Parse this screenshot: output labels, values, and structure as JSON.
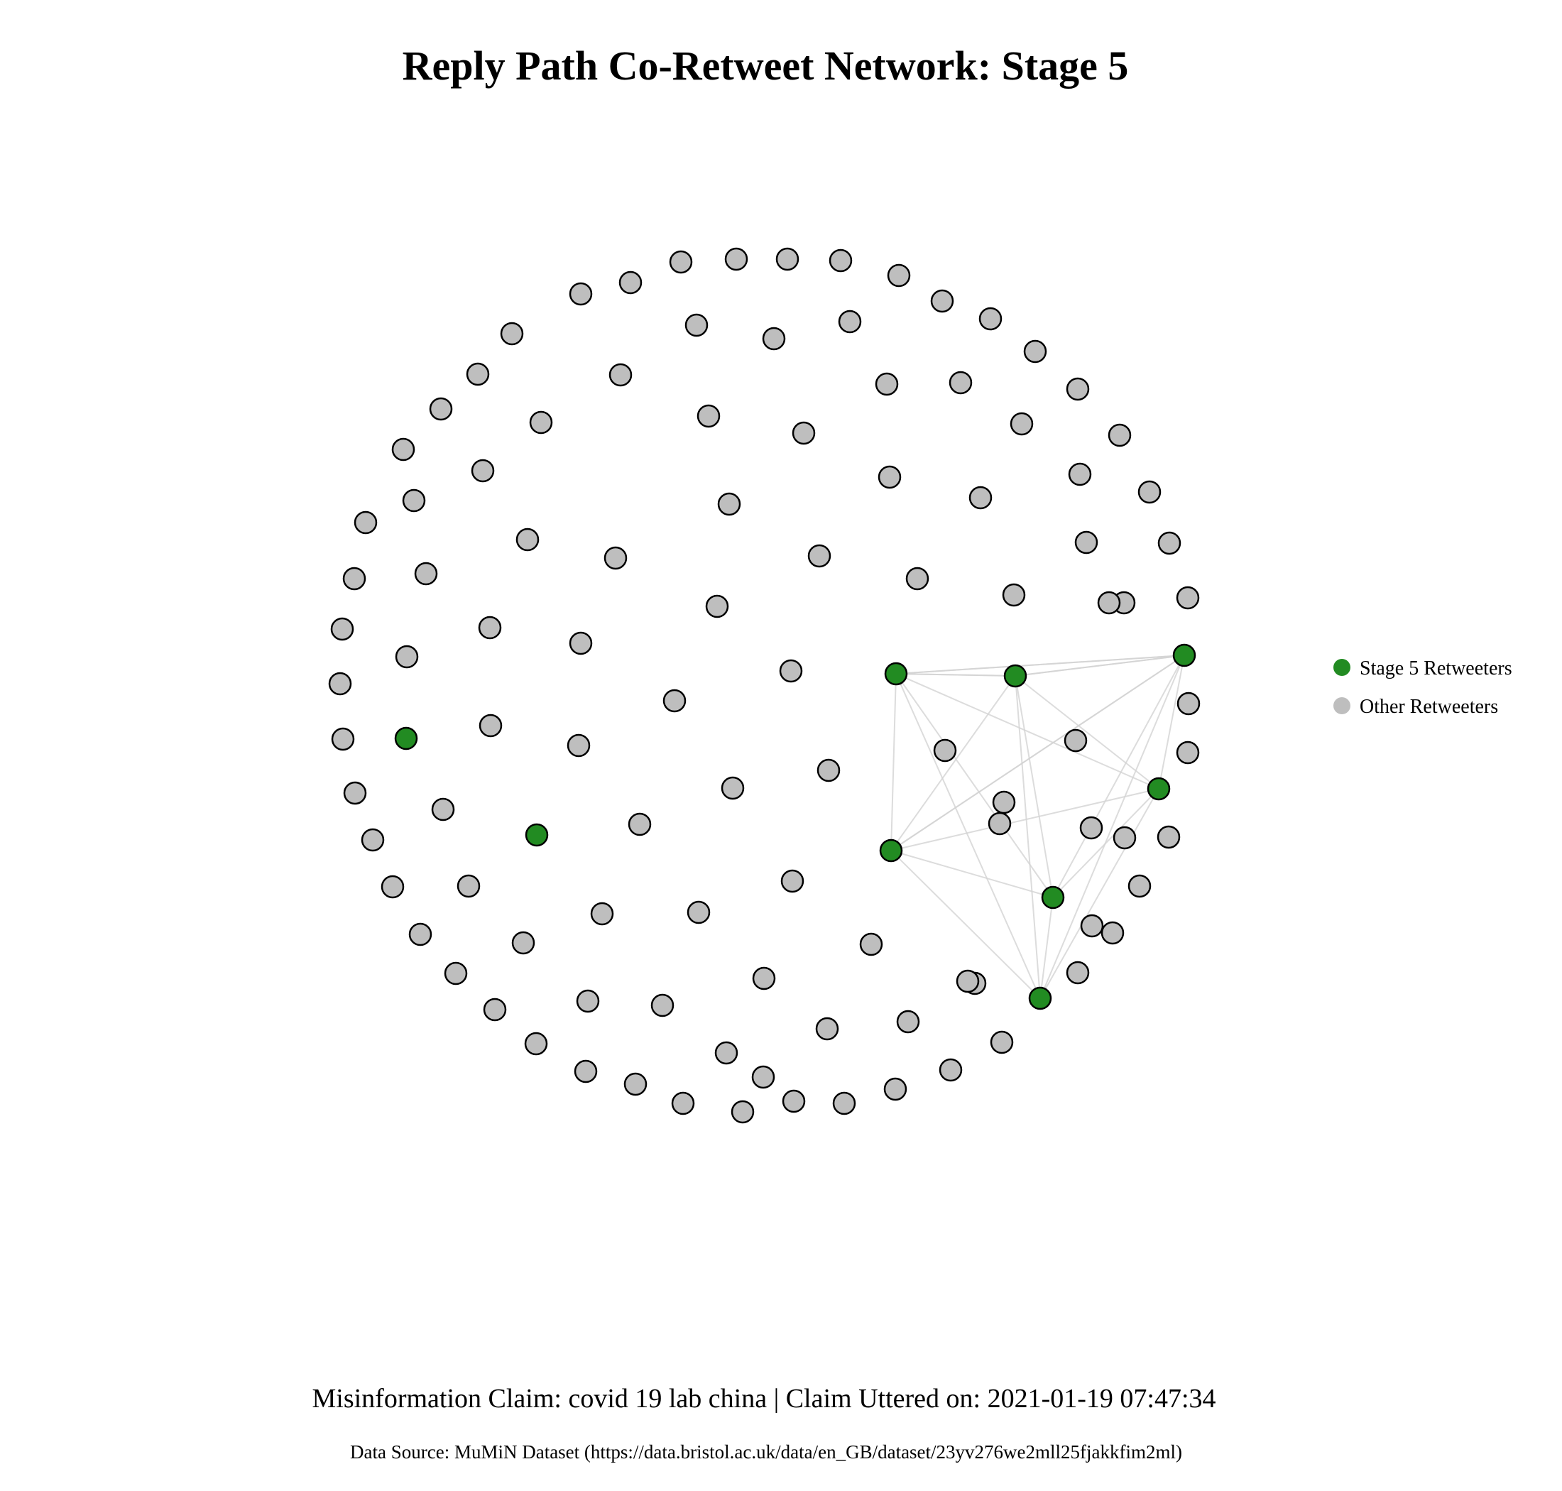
{
  "title": "Reply Path Co-Retweet Network: Stage 5",
  "caption": "Misinformation Claim: covid 19 lab china | Claim Uttered on: 2021-01-19 07:47:34",
  "source": "Data Source: MuMiN Dataset (https://data.bristol.ac.uk/data/en_GB/dataset/23yv276we2mll25fjakkfim2ml)",
  "legend": {
    "items": [
      {
        "label": "Stage 5 Retweeters",
        "color": "#228B22"
      },
      {
        "label": "Other Retweeters",
        "color": "#BEBEBE"
      }
    ]
  },
  "colors": {
    "stage5": "#228B22",
    "other": "#BEBEBE",
    "node_stroke": "#000000",
    "edge": "#D3D3D3"
  },
  "chart_data": {
    "type": "network",
    "groups": [
      "Stage 5 Retweeters",
      "Other Retweeters"
    ],
    "node_count": 133,
    "stage5_node_count": 9,
    "edge_count": 25
  }
}
